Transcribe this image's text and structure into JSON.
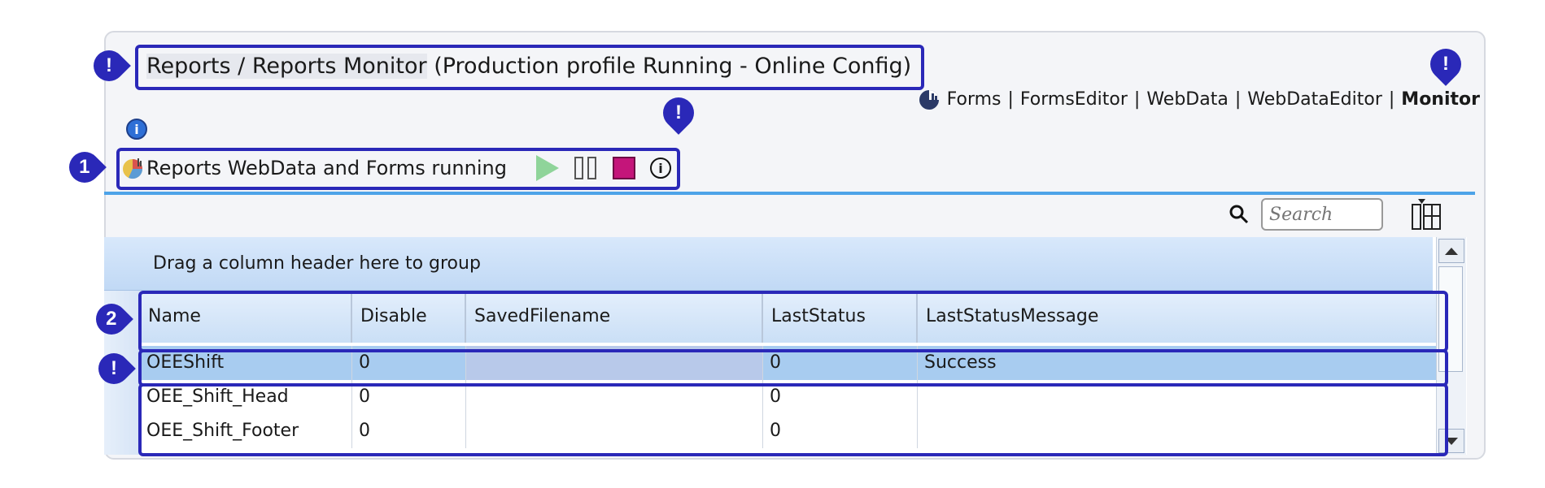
{
  "title": {
    "crumb": "Reports / Reports Monitor",
    "status": " (Production profile Running - Online Config)"
  },
  "nav": {
    "links": [
      "Forms",
      "|",
      "FormsEditor",
      "|",
      "WebData",
      "|",
      "WebDataEditor",
      "|"
    ],
    "active": "Monitor"
  },
  "toolbar": {
    "label": "Reports WebData and Forms running"
  },
  "search": {
    "placeholder": "Search"
  },
  "grid": {
    "group_hint": "Drag a column header here to group",
    "columns": [
      "Name",
      "Disable",
      "SavedFilename",
      "LastStatus",
      "LastStatusMessage"
    ],
    "rows": [
      [
        "OEEShift",
        "0",
        "",
        "0",
        "Success"
      ],
      [
        "OEE_Shift_Head",
        "0",
        "",
        "0",
        ""
      ],
      [
        "OEE_Shift_Footer",
        "0",
        "",
        "0",
        ""
      ]
    ]
  },
  "markers": {
    "excl": "!",
    "one": "1",
    "two": "2"
  },
  "icons": {
    "info": "i"
  },
  "colors": {
    "highlight": "#2a28b8",
    "accent": "#4da3e8",
    "stop": "#c4157a",
    "play": "#8fd49a"
  }
}
